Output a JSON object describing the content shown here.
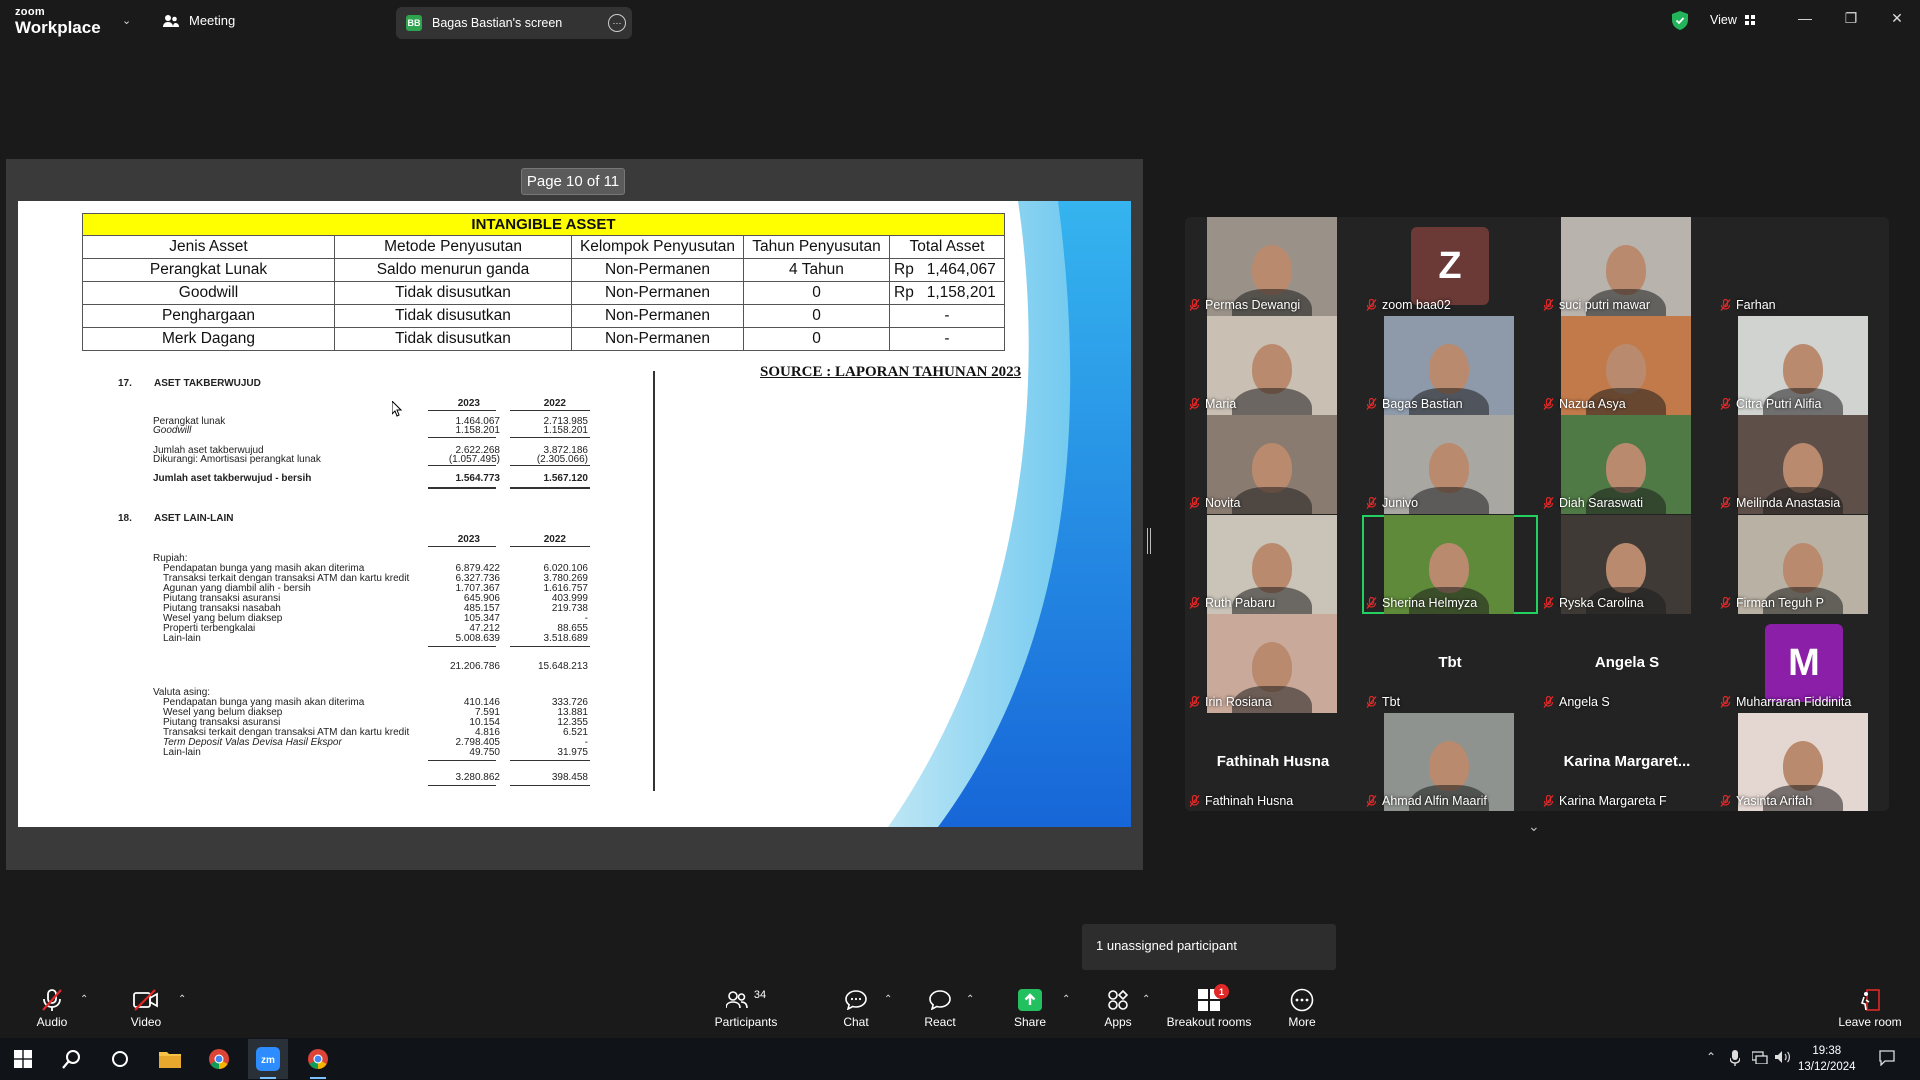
{
  "app": {
    "logo_line1": "zoom",
    "logo_line2": "Workplace",
    "meeting_label": "Meeting",
    "sharing_initials": "BB",
    "sharing_label": "Bagas Bastian's screen",
    "view_label": "View"
  },
  "share": {
    "page_indicator": "Page 10 of 11",
    "table": {
      "title": "INTANGIBLE ASSET",
      "headers": [
        "Jenis Asset",
        "Metode Penyusutan",
        "Kelompok Penyusutan",
        "Tahun Penyusutan",
        "Total Asset"
      ],
      "rows": [
        [
          "Perangkat Lunak",
          "Saldo menurun ganda",
          "Non-Permanen",
          "4 Tahun",
          "Rp   1,464,067"
        ],
        [
          "Goodwill",
          "Tidak disusutkan",
          "Non-Permanen",
          "0",
          "Rp   1,158,201"
        ],
        [
          "Penghargaan",
          "Tidak disusutkan",
          "Non-Permanen",
          "0",
          "-"
        ],
        [
          "Merk Dagang",
          "Tidak disusutkan",
          "Non-Permanen",
          "0",
          "-"
        ]
      ]
    },
    "source": "SOURCE : LAPORAN TAHUNAN 2023",
    "sec17": {
      "num": "17.",
      "title": "ASET TAKBERWUJUD",
      "y1": "2023",
      "y2": "2022",
      "r1_label": "Perangkat lunak",
      "r1_a": "1.464.067",
      "r1_b": "2.713.985",
      "r2_label": "Goodwill",
      "r2_a": "1.158.201",
      "r2_b": "1.158.201",
      "r3_label": "Jumlah aset takberwujud",
      "r3_a": "2.622.268",
      "r3_b": "3.872.186",
      "r4_label": "Dikurangi: Amortisasi perangkat lunak",
      "r4_a": "(1.057.495)",
      "r4_b": "(2.305.066)",
      "r5_label": "Jumlah aset takberwujud - bersih",
      "r5_a": "1.564.773",
      "r5_b": "1.567.120"
    },
    "sec18": {
      "num": "18.",
      "title": "ASET LAIN-LAIN",
      "y1": "2023",
      "y2": "2022",
      "rupiah": "Rupiah:",
      "rows": [
        [
          "Pendapatan bunga yang masih akan diterima",
          "6.879.422",
          "6.020.106"
        ],
        [
          "Transaksi terkait dengan transaksi ATM dan kartu kredit",
          "6.327.736",
          "3.780.269"
        ],
        [
          "Agunan yang diambil alih - bersih",
          "1.707.367",
          "1.616.757"
        ],
        [
          "Piutang transaksi asuransi",
          "645.906",
          "403.999"
        ],
        [
          "Piutang transaksi nasabah",
          "485.157",
          "219.738"
        ],
        [
          "Wesel yang belum diaksep",
          "105.347",
          "-"
        ],
        [
          "Properti terbengkalai",
          "47.212",
          "88.655"
        ],
        [
          "Lain-lain",
          "5.008.639",
          "3.518.689"
        ]
      ],
      "total1_a": "21.206.786",
      "total1_b": "15.648.213",
      "valuta": "Valuta asing:",
      "rows2": [
        [
          "Pendapatan bunga yang masih akan diterima",
          "410.146",
          "333.726"
        ],
        [
          "Wesel yang belum diaksep",
          "7.591",
          "13.881"
        ],
        [
          "Piutang transaksi asuransi",
          "10.154",
          "12.355"
        ],
        [
          "Transaksi terkait dengan transaksi ATM dan kartu kredit",
          "4.816",
          "6.521"
        ],
        [
          "Term Deposit Valas Devisa Hasil Ekspor",
          "2.798.405",
          "-"
        ],
        [
          "Lain-lain",
          "49.750",
          "31.975"
        ]
      ],
      "total2_a": "3.280.862",
      "total2_b": "398.458"
    }
  },
  "participants": [
    {
      "name": "Permas Dewangi",
      "kind": "video",
      "bg": "#9a9288"
    },
    {
      "name": "zoom baa02",
      "kind": "avatar",
      "letter": "Z",
      "color": "#6b3a36"
    },
    {
      "name": "suci putri mawar",
      "kind": "video",
      "bg": "#b9b3ad"
    },
    {
      "name": "Farhan",
      "kind": "blank"
    },
    {
      "name": "Maria",
      "kind": "video",
      "bg": "#c9bfb3"
    },
    {
      "name": "Bagas Bastian",
      "kind": "video",
      "bg": "#8e9aaa"
    },
    {
      "name": "Nazua Asya",
      "kind": "video",
      "bg": "#c37a4a"
    },
    {
      "name": "Citra Putri Alifia",
      "kind": "video",
      "bg": "#d0d3d0"
    },
    {
      "name": "Novita",
      "kind": "video",
      "bg": "#8a7b70"
    },
    {
      "name": "Junivo",
      "kind": "video",
      "bg": "#a8a7a2"
    },
    {
      "name": "Diah Saraswati",
      "kind": "video",
      "bg": "#4f7a45"
    },
    {
      "name": "Meilinda Anastasia",
      "kind": "video",
      "bg": "#5e4f48"
    },
    {
      "name": "Ruth Pabaru",
      "kind": "video",
      "bg": "#c9c3b8"
    },
    {
      "name": "Sherina Helmyza",
      "kind": "video",
      "bg": "#5f8a3a"
    },
    {
      "name": "Ryska Carolina",
      "kind": "video",
      "bg": "#3f3a35"
    },
    {
      "name": "Firman Teguh P",
      "kind": "video",
      "bg": "#b9b1a3"
    },
    {
      "name": "Irin Rosiana",
      "kind": "video",
      "bg": "#c9a99a"
    },
    {
      "name": "Tbt",
      "kind": "text"
    },
    {
      "name": "Angela S",
      "kind": "text"
    },
    {
      "name": "Muharraran Fiddinita",
      "kind": "avatar",
      "letter": "M",
      "color": "#8b1fa8"
    },
    {
      "name": "Fathinah Husna",
      "kind": "text"
    },
    {
      "name": "Ahmad Alfin Maarif",
      "kind": "video",
      "bg": "#8f938f"
    },
    {
      "name": "Karina Margareta F",
      "kind": "text",
      "display": "Karina  Margaret..."
    },
    {
      "name": "Yasinta Arifah",
      "kind": "video",
      "bg": "#e4d6d0"
    }
  ],
  "notice": "1 unassigned participant",
  "toolbar": {
    "audio": "Audio",
    "video": "Video",
    "participants": "Participants",
    "participants_count": "34",
    "chat": "Chat",
    "react": "React",
    "share": "Share",
    "apps": "Apps",
    "breakout": "Breakout rooms",
    "breakout_badge": "1",
    "more": "More",
    "leave": "Leave room"
  },
  "taskbar": {
    "time": "19:38",
    "date": "13/12/2024"
  }
}
